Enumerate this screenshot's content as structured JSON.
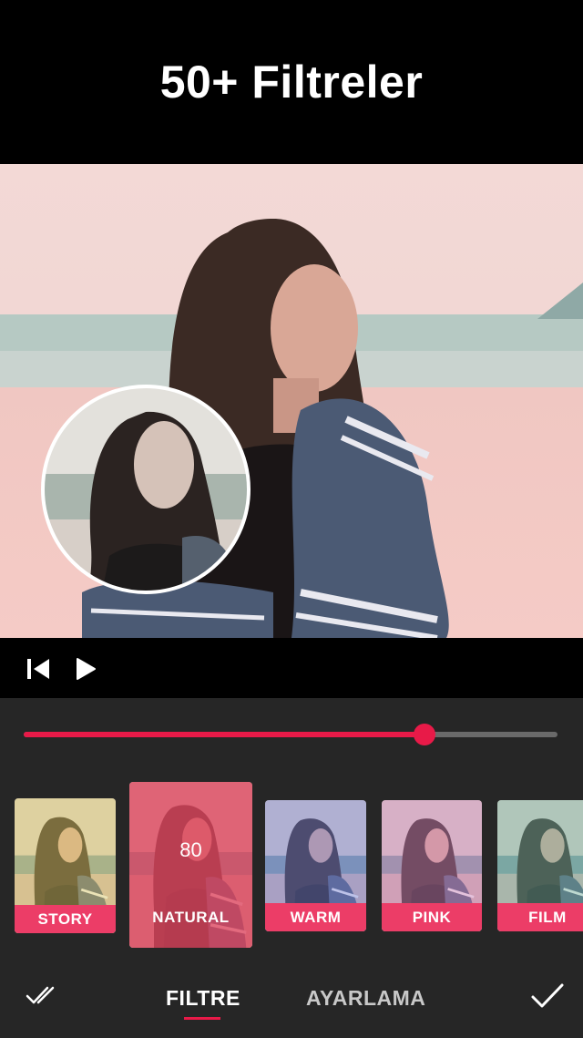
{
  "header": {
    "title": "50+ Filtreler"
  },
  "player": {
    "prev_icon": "skip-previous-icon",
    "play_icon": "play-icon"
  },
  "intensity": {
    "value": 80,
    "fraction": 0.75
  },
  "filters": [
    {
      "label": "STORY",
      "tint": "#e8d36a"
    },
    {
      "label": "NATURAL",
      "tint": "#e0455f",
      "selected": true,
      "value": "80"
    },
    {
      "label": "WARM",
      "tint": "#7a86e0"
    },
    {
      "label": "PINK",
      "tint": "#d685c4"
    },
    {
      "label": "FILM",
      "tint": "#79b9a6"
    }
  ],
  "tabs": {
    "filtre": "FILTRE",
    "ayarlama": "AYARLAMA"
  },
  "colors": {
    "accent": "#e81a48",
    "label_bg": "#ec3d67",
    "panel": "#262626"
  }
}
